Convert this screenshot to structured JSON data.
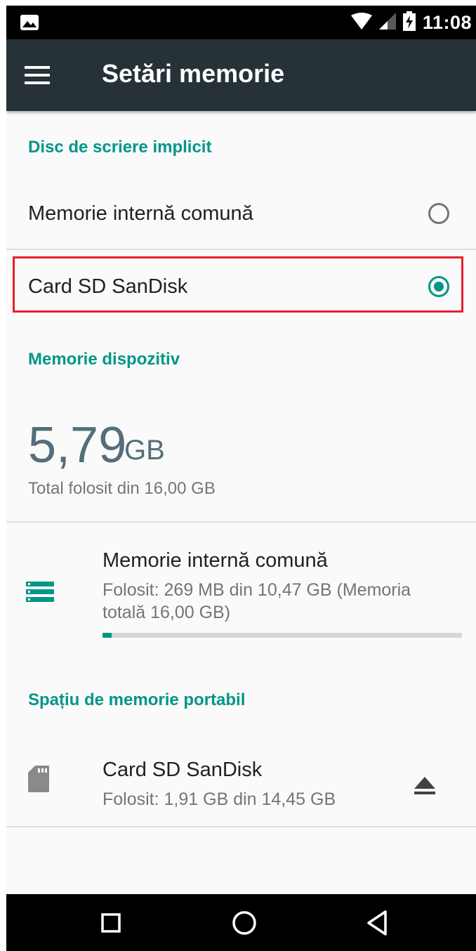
{
  "status_bar": {
    "time": "11:08"
  },
  "toolbar": {
    "title": "Setări memorie"
  },
  "default_write_disk": {
    "header": "Disc de scriere implicit",
    "options": [
      {
        "label": "Memorie internă comună",
        "selected": false
      },
      {
        "label": "Card SD SanDisk",
        "selected": true
      }
    ]
  },
  "device_storage": {
    "header": "Memorie dispozitiv",
    "used_value": "5,79",
    "used_unit": "GB",
    "total_text": "Total folosit din 16,00 GB",
    "internal": {
      "title": "Memorie internă comună",
      "subtitle": "Folosit: 269 MB din 10,47 GB (Memoria totală 16,00 GB)",
      "usage_fraction": 0.025
    }
  },
  "portable_storage": {
    "header": "Spațiu de memorie portabil",
    "sd_card": {
      "title": "Card SD SanDisk",
      "subtitle": "Folosit: 1,91 GB din 14,45 GB"
    }
  },
  "colors": {
    "accent": "#009688",
    "toolbar": "#263238",
    "highlight": "#e5202e"
  }
}
